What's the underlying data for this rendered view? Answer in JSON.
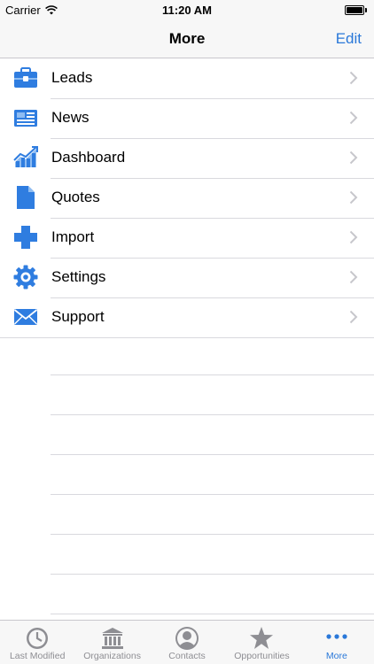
{
  "status": {
    "carrier": "Carrier",
    "time": "11:20 AM"
  },
  "nav": {
    "title": "More",
    "edit_label": "Edit"
  },
  "list": {
    "items": [
      {
        "label": "Leads",
        "icon": "briefcase-icon"
      },
      {
        "label": "News",
        "icon": "newspaper-icon"
      },
      {
        "label": "Dashboard",
        "icon": "chart-icon"
      },
      {
        "label": "Quotes",
        "icon": "document-icon"
      },
      {
        "label": "Import",
        "icon": "plus-icon"
      },
      {
        "label": "Settings",
        "icon": "gear-icon"
      },
      {
        "label": "Support",
        "icon": "envelope-icon"
      }
    ]
  },
  "tabs": [
    {
      "label": "Last Modified",
      "icon": "clock-icon",
      "active": false
    },
    {
      "label": "Organizations",
      "icon": "building-icon",
      "active": false
    },
    {
      "label": "Contacts",
      "icon": "person-icon",
      "active": false
    },
    {
      "label": "Opportunities",
      "icon": "star-icon",
      "active": false
    },
    {
      "label": "More",
      "icon": "more-dots-icon",
      "active": true
    }
  ],
  "colors": {
    "accent": "#2a78d9",
    "icon_blue": "#2f7de0",
    "tab_gray": "#8e8e93"
  }
}
